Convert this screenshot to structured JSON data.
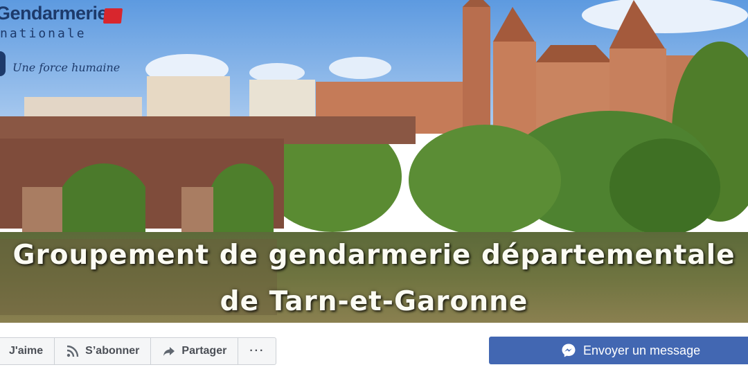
{
  "cover": {
    "logo_title": "Gendarmerie",
    "logo_subtitle": "nationale",
    "motto": "Une force humaine",
    "title_line1": "Groupement de gendarmerie départementale",
    "title_line2": "de Tarn-et-Garonne"
  },
  "actions": {
    "like_label": "J'aime",
    "subscribe_label": "S’abonner",
    "share_label": "Partager",
    "more_label": "···",
    "message_label": "Envoyer un message"
  },
  "colors": {
    "brand_blue": "#4267b2",
    "gendarmerie_navy": "#1d3a6b",
    "flag_red": "#d8262d"
  }
}
